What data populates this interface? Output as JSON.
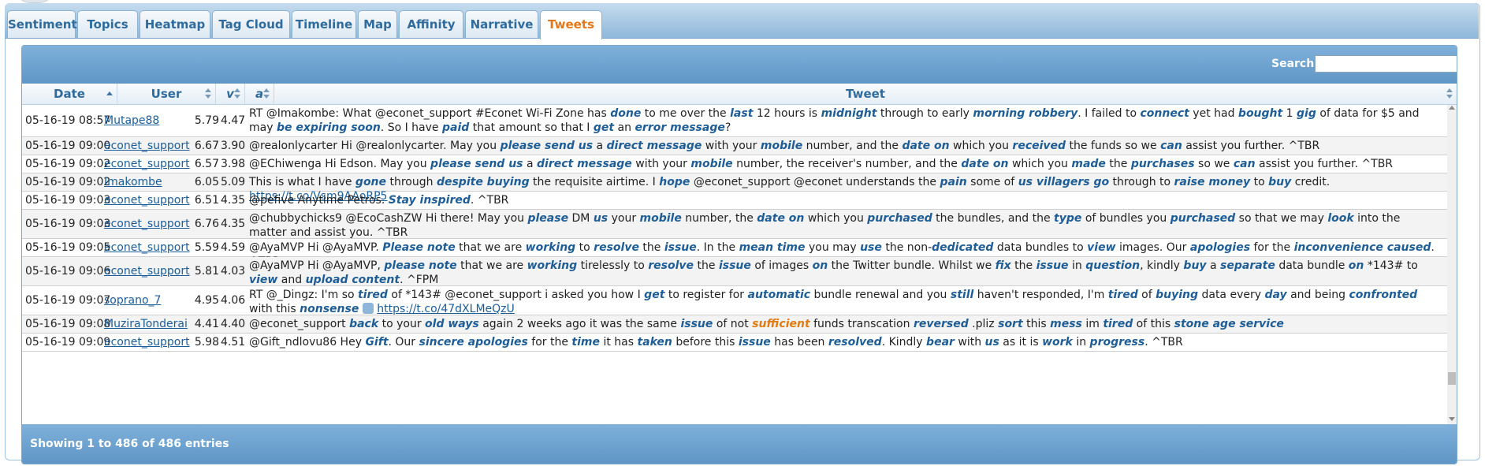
{
  "tabs": [
    {
      "label": "Sentiment",
      "active": false
    },
    {
      "label": "Topics",
      "active": false
    },
    {
      "label": "Heatmap",
      "active": false
    },
    {
      "label": "Tag Cloud",
      "active": false
    },
    {
      "label": "Timeline",
      "active": false
    },
    {
      "label": "Map",
      "active": false
    },
    {
      "label": "Affinity",
      "active": false
    },
    {
      "label": "Narrative",
      "active": false
    },
    {
      "label": "Tweets",
      "active": true
    }
  ],
  "search": {
    "label": "Search:",
    "value": ""
  },
  "columns": {
    "date": "Date",
    "user": "User",
    "v": "v",
    "a": "a",
    "tweet": "Tweet"
  },
  "rows": [
    {
      "date": "05-16-19 08:57",
      "user": "Mutape88",
      "v": "5.79",
      "a": "4.47",
      "tweet": [
        {
          "t": "RT @Imakombe: What @econet_support #Econet Wi-Fi Zone has "
        },
        {
          "t": "done",
          "w": 1
        },
        {
          "t": " to me over the "
        },
        {
          "t": "last",
          "w": 1
        },
        {
          "t": " 12 hours is "
        },
        {
          "t": "midnight",
          "w": 1
        },
        {
          "t": " through to early "
        },
        {
          "t": "morning robbery",
          "w": 1
        },
        {
          "t": ". I failed to "
        },
        {
          "t": "connect",
          "w": 1
        },
        {
          "t": " yet had "
        },
        {
          "t": "bought",
          "w": 1
        },
        {
          "t": " 1 "
        },
        {
          "t": "gig",
          "w": 1
        },
        {
          "t": " of data for $5 and may "
        },
        {
          "t": "be expiring soon",
          "w": 1
        },
        {
          "t": ". So I have "
        },
        {
          "t": "paid",
          "w": 1
        },
        {
          "t": " that amount so that I "
        },
        {
          "t": "get",
          "w": 1
        },
        {
          "t": " an "
        },
        {
          "t": "error message",
          "w": 1
        },
        {
          "t": "?"
        }
      ]
    },
    {
      "date": "05-16-19 09:00",
      "user": "econet_support",
      "v": "6.67",
      "a": "3.90",
      "tweet": [
        {
          "t": "@realonlycarter Hi @realonlycarter. May you "
        },
        {
          "t": "please send us",
          "w": 1
        },
        {
          "t": " a "
        },
        {
          "t": "direct message",
          "w": 1
        },
        {
          "t": " with your "
        },
        {
          "t": "mobile",
          "w": 1
        },
        {
          "t": " number, and the "
        },
        {
          "t": "date on",
          "w": 1
        },
        {
          "t": " which you "
        },
        {
          "t": "received",
          "w": 1
        },
        {
          "t": " the funds so we "
        },
        {
          "t": "can",
          "w": 1
        },
        {
          "t": " assist you further. ^TBR"
        }
      ]
    },
    {
      "date": "05-16-19 09:02",
      "user": "econet_support",
      "v": "6.57",
      "a": "3.98",
      "tweet": [
        {
          "t": "@EChiwenga Hi Edson. May you "
        },
        {
          "t": "please send us",
          "w": 1
        },
        {
          "t": " a "
        },
        {
          "t": "direct message",
          "w": 1
        },
        {
          "t": " with your "
        },
        {
          "t": "mobile",
          "w": 1
        },
        {
          "t": " number, the receiver's number, and the "
        },
        {
          "t": "date on",
          "w": 1
        },
        {
          "t": " which you "
        },
        {
          "t": "made",
          "w": 1
        },
        {
          "t": " the "
        },
        {
          "t": "purchases",
          "w": 1
        },
        {
          "t": " so we "
        },
        {
          "t": "can",
          "w": 1
        },
        {
          "t": " assist you further. ^TBR"
        }
      ]
    },
    {
      "date": "05-16-19 09:02",
      "user": "Imakombe",
      "v": "6.05",
      "a": "5.09",
      "tweet": [
        {
          "t": "This is what I have "
        },
        {
          "t": "gone",
          "w": 1
        },
        {
          "t": " through "
        },
        {
          "t": "despite buying",
          "w": 1
        },
        {
          "t": " the requisite airtime. I "
        },
        {
          "t": "hope",
          "w": 1
        },
        {
          "t": " @econet_support @econet understands the "
        },
        {
          "t": "pain",
          "w": 1
        },
        {
          "t": " some of "
        },
        {
          "t": "us villagers go",
          "w": 1
        },
        {
          "t": " through to "
        },
        {
          "t": "raise money",
          "w": 1
        },
        {
          "t": " to "
        },
        {
          "t": "buy",
          "w": 1
        },
        {
          "t": " credit. "
        },
        {
          "t": "https://t.co/Vsm9AAoRP5",
          "l": 1
        }
      ]
    },
    {
      "date": "05-16-19 09:03",
      "user": "econet_support",
      "v": "6.51",
      "a": "4.35",
      "tweet": [
        {
          "t": "@pefive Anytime Petros. "
        },
        {
          "t": "Stay inspired",
          "w": 1
        },
        {
          "t": ". ^TBR"
        }
      ]
    },
    {
      "date": "05-16-19 09:03",
      "user": "econet_support",
      "v": "6.76",
      "a": "4.35",
      "tweet": [
        {
          "t": "@chubbychicks9 @EcoCashZW Hi there! May you "
        },
        {
          "t": "please",
          "w": 1
        },
        {
          "t": " DM "
        },
        {
          "t": "us",
          "w": 1
        },
        {
          "t": " your "
        },
        {
          "t": "mobile",
          "w": 1
        },
        {
          "t": " number, the "
        },
        {
          "t": "date on",
          "w": 1
        },
        {
          "t": " which you "
        },
        {
          "t": "purchased",
          "w": 1
        },
        {
          "t": " the bundles, and the "
        },
        {
          "t": "type",
          "w": 1
        },
        {
          "t": " of bundles you "
        },
        {
          "t": "purchased",
          "w": 1
        },
        {
          "t": " so that we may "
        },
        {
          "t": "look",
          "w": 1
        },
        {
          "t": " into the matter and assist you. ^TBR"
        }
      ]
    },
    {
      "date": "05-16-19 09:05",
      "user": "econet_support",
      "v": "5.59",
      "a": "4.59",
      "tweet": [
        {
          "t": "@AyaMVP Hi @AyaMVP. "
        },
        {
          "t": "Please note",
          "w": 1
        },
        {
          "t": " that we are "
        },
        {
          "t": "working",
          "w": 1
        },
        {
          "t": " to "
        },
        {
          "t": "resolve",
          "w": 1
        },
        {
          "t": " the "
        },
        {
          "t": "issue",
          "w": 1
        },
        {
          "t": ". In the "
        },
        {
          "t": "mean time",
          "w": 1
        },
        {
          "t": " you may "
        },
        {
          "t": "use",
          "w": 1
        },
        {
          "t": " the non-"
        },
        {
          "t": "dedicated",
          "w": 1
        },
        {
          "t": " data bundles to "
        },
        {
          "t": "view",
          "w": 1
        },
        {
          "t": " images. Our "
        },
        {
          "t": "apologies",
          "w": 1
        },
        {
          "t": " for the "
        },
        {
          "t": "inconvenience caused",
          "w": 1
        },
        {
          "t": ". ^TBR"
        }
      ]
    },
    {
      "date": "05-16-19 09:06",
      "user": "econet_support",
      "v": "5.81",
      "a": "4.03",
      "tweet": [
        {
          "t": "@AyaMVP Hi @AyaMVP, "
        },
        {
          "t": "please note",
          "w": 1
        },
        {
          "t": " that we are "
        },
        {
          "t": "working",
          "w": 1
        },
        {
          "t": " tirelessly to "
        },
        {
          "t": "resolve",
          "w": 1
        },
        {
          "t": " the "
        },
        {
          "t": "issue",
          "w": 1
        },
        {
          "t": " of images "
        },
        {
          "t": "on",
          "w": 1
        },
        {
          "t": " the Twitter bundle. Whilst we "
        },
        {
          "t": "fix",
          "w": 1
        },
        {
          "t": " the "
        },
        {
          "t": "issue",
          "w": 1
        },
        {
          "t": " in "
        },
        {
          "t": "question",
          "w": 1
        },
        {
          "t": ", kindly "
        },
        {
          "t": "buy",
          "w": 1
        },
        {
          "t": " a "
        },
        {
          "t": "separate",
          "w": 1
        },
        {
          "t": " data bundle "
        },
        {
          "t": "on",
          "w": 1
        },
        {
          "t": " *143# to "
        },
        {
          "t": "view",
          "w": 1
        },
        {
          "t": " and "
        },
        {
          "t": "upload content",
          "w": 1
        },
        {
          "t": ". ^FPM"
        }
      ]
    },
    {
      "date": "05-16-19 09:07",
      "user": "soprano_7",
      "v": "4.95",
      "a": "4.06",
      "tweet": [
        {
          "t": "RT @_Dingz: I'm so "
        },
        {
          "t": "tired",
          "w": 1
        },
        {
          "t": " of *143# @econet_support i asked you how I "
        },
        {
          "t": "get",
          "w": 1
        },
        {
          "t": " to register for "
        },
        {
          "t": "automatic",
          "w": 1
        },
        {
          "t": " bundle renewal and you "
        },
        {
          "t": "still",
          "w": 1
        },
        {
          "t": " haven't responded, I'm "
        },
        {
          "t": "tired",
          "w": 1
        },
        {
          "t": " of "
        },
        {
          "t": "buying",
          "w": 1
        },
        {
          "t": " data every "
        },
        {
          "t": "day",
          "w": 1
        },
        {
          "t": " and being "
        },
        {
          "t": "confronted",
          "w": 1
        },
        {
          "t": " with this "
        },
        {
          "t": "nonsense",
          "w": 1
        },
        {
          "t": " "
        },
        {
          "e": 1
        },
        {
          "t": " "
        },
        {
          "t": "https://t.co/47dXLMeQzU",
          "l": 1
        }
      ]
    },
    {
      "date": "05-16-19 09:08",
      "user": "MuziraTonderai",
      "v": "4.41",
      "a": "4.40",
      "tweet": [
        {
          "t": "@econet_support "
        },
        {
          "t": "back",
          "w": 1
        },
        {
          "t": " to your "
        },
        {
          "t": "old ways",
          "w": 1
        },
        {
          "t": " again 2 weeks ago it was the same "
        },
        {
          "t": "issue",
          "w": 1
        },
        {
          "t": " of not "
        },
        {
          "t": "sufficient",
          "o": 1
        },
        {
          "t": " funds transcation "
        },
        {
          "t": "reversed",
          "w": 1
        },
        {
          "t": " .pliz "
        },
        {
          "t": "sort",
          "w": 1
        },
        {
          "t": " this "
        },
        {
          "t": "mess",
          "w": 1
        },
        {
          "t": " im "
        },
        {
          "t": "tired",
          "w": 1
        },
        {
          "t": " of this "
        },
        {
          "t": "stone age service",
          "w": 1
        }
      ]
    },
    {
      "date": "05-16-19 09:09",
      "user": "econet_support",
      "v": "5.98",
      "a": "4.51",
      "tweet": [
        {
          "t": "@Gift_ndlovu86 Hey "
        },
        {
          "t": "Gift",
          "w": 1
        },
        {
          "t": ". Our "
        },
        {
          "t": "sincere apologies",
          "w": 1
        },
        {
          "t": " for the "
        },
        {
          "t": "time",
          "w": 1
        },
        {
          "t": " it has "
        },
        {
          "t": "taken",
          "w": 1
        },
        {
          "t": " before this "
        },
        {
          "t": "issue",
          "w": 1
        },
        {
          "t": " has been "
        },
        {
          "t": "resolved",
          "w": 1
        },
        {
          "t": ". Kindly "
        },
        {
          "t": "bear",
          "w": 1
        },
        {
          "t": " with "
        },
        {
          "t": "us",
          "w": 1
        },
        {
          "t": " as it is "
        },
        {
          "t": "work",
          "w": 1
        },
        {
          "t": " in "
        },
        {
          "t": "progress",
          "w": 1
        },
        {
          "t": ". ^TBR"
        }
      ]
    }
  ],
  "footer": {
    "info": "Showing 1 to 486 of 486 entries"
  },
  "colors": {
    "accent": "#e5771b",
    "header_blue": "#6fa3d0",
    "link": "#1b5d99"
  }
}
